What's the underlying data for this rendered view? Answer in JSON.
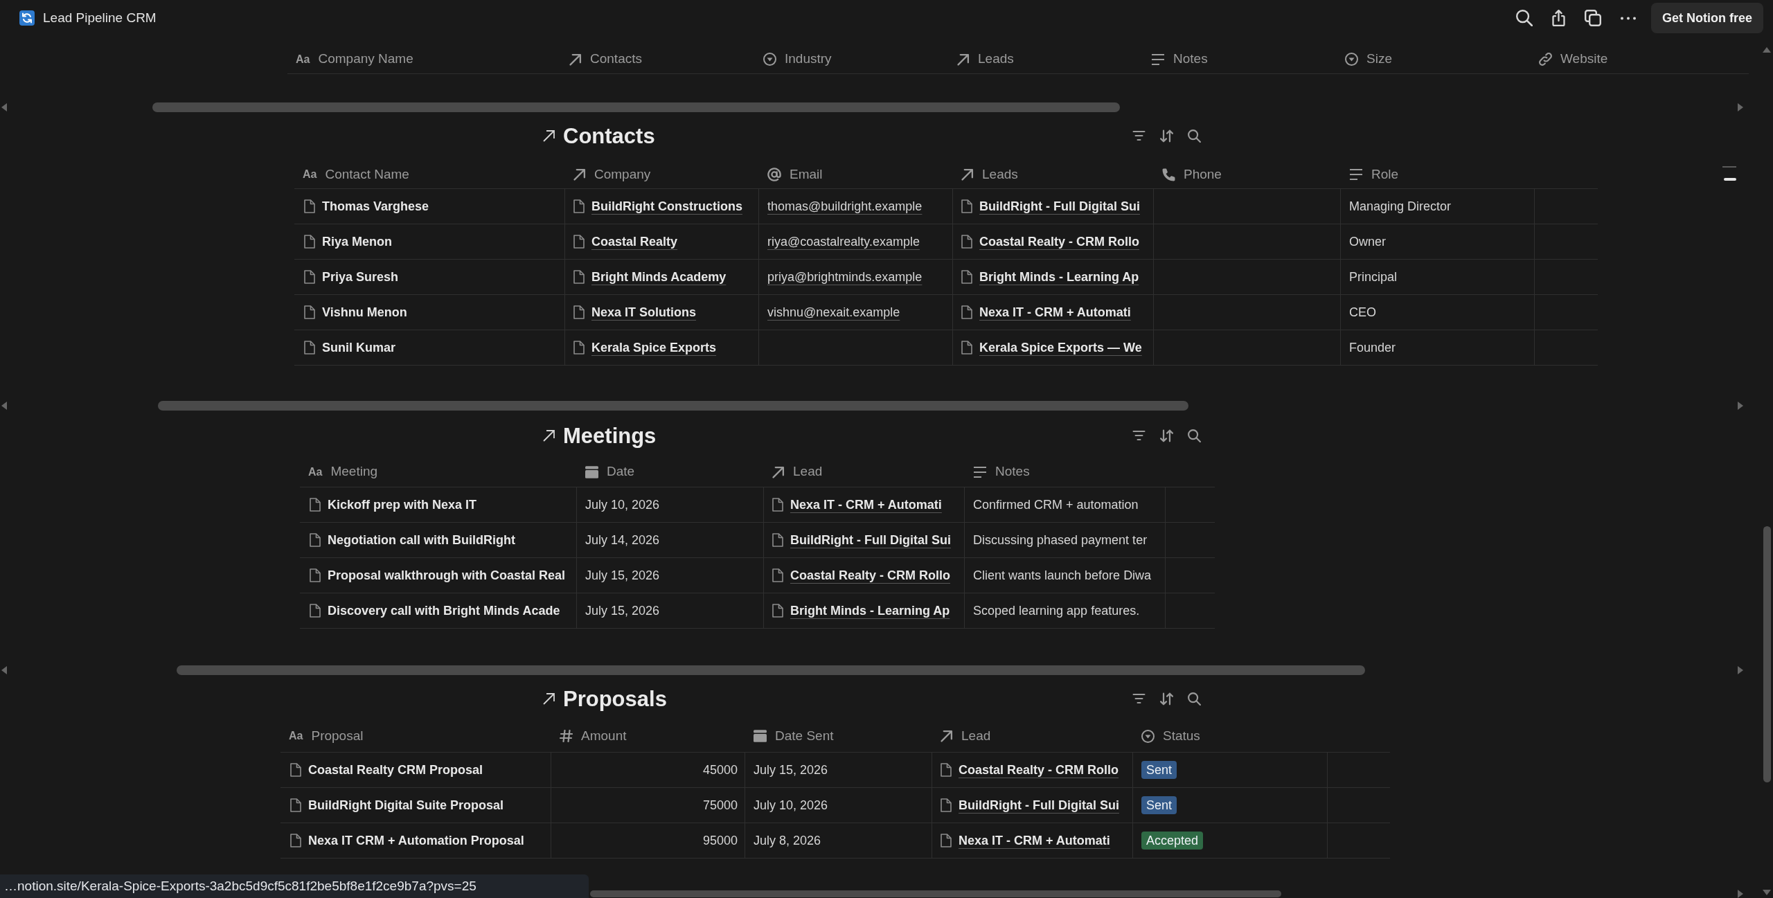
{
  "topbar": {
    "page_title": "Lead Pipeline CRM",
    "cta_button": "Get Notion free"
  },
  "companies_table": {
    "columns": [
      {
        "label": "Company Name",
        "kind": "title",
        "type_glyph": "Aa"
      },
      {
        "label": "Contacts",
        "kind": "relation"
      },
      {
        "label": "Industry",
        "kind": "select"
      },
      {
        "label": "Leads",
        "kind": "relation"
      },
      {
        "label": "Notes",
        "kind": "text"
      },
      {
        "label": "Size",
        "kind": "select"
      },
      {
        "label": "Website",
        "kind": "url"
      }
    ]
  },
  "sections": [
    {
      "title": "Contacts",
      "columns": [
        {
          "label": "Contact Name",
          "kind": "title",
          "type_glyph": "Aa"
        },
        {
          "label": "Company",
          "kind": "relation"
        },
        {
          "label": "Email",
          "kind": "email"
        },
        {
          "label": "Leads",
          "kind": "relation"
        },
        {
          "label": "Phone",
          "kind": "phone"
        },
        {
          "label": "Role",
          "kind": "text"
        }
      ],
      "rows": [
        [
          "Thomas Varghese",
          "BuildRight Constructions",
          "thomas@buildright.example",
          "BuildRight - Full Digital Sui",
          null,
          "Managing Director"
        ],
        [
          "Riya Menon",
          "Coastal Realty",
          "riya@coastalrealty.example",
          "Coastal Realty - CRM Rollo",
          null,
          "Owner"
        ],
        [
          "Priya Suresh",
          "Bright Minds Academy",
          "priya@brightminds.example",
          "Bright Minds - Learning Ap",
          null,
          "Principal"
        ],
        [
          "Vishnu Menon",
          "Nexa IT Solutions",
          "vishnu@nexait.example",
          "Nexa IT - CRM + Automati",
          null,
          "CEO"
        ],
        [
          "Sunil Kumar",
          "Kerala Spice Exports",
          null,
          "Kerala Spice Exports — We",
          null,
          "Founder"
        ]
      ]
    },
    {
      "title": "Meetings",
      "columns": [
        {
          "label": "Meeting",
          "kind": "title",
          "type_glyph": "Aa"
        },
        {
          "label": "Date",
          "kind": "date"
        },
        {
          "label": "Lead",
          "kind": "relation"
        },
        {
          "label": "Notes",
          "kind": "text"
        }
      ],
      "rows": [
        [
          "Kickoff prep with Nexa IT",
          "July 10, 2026",
          "Nexa IT - CRM + Automati",
          "Confirmed CRM + automation"
        ],
        [
          "Negotiation call with BuildRight",
          "July 14, 2026",
          "BuildRight - Full Digital Sui",
          "Discussing phased payment ter"
        ],
        [
          "Proposal walkthrough with Coastal Real",
          "July 15, 2026",
          "Coastal Realty - CRM Rollo",
          "Client wants launch before Diwa"
        ],
        [
          "Discovery call with Bright Minds Acade",
          "July 15, 2026",
          "Bright Minds - Learning Ap",
          "Scoped learning app features."
        ]
      ]
    },
    {
      "title": "Proposals",
      "columns": [
        {
          "label": "Proposal",
          "kind": "title",
          "type_glyph": "Aa"
        },
        {
          "label": "Amount",
          "kind": "number"
        },
        {
          "label": "Date Sent",
          "kind": "date"
        },
        {
          "label": "Lead",
          "kind": "relation"
        },
        {
          "label": "Status",
          "kind": "select"
        }
      ],
      "rows": [
        [
          "Coastal Realty CRM Proposal",
          "45000",
          "July 15, 2026",
          "Coastal Realty - CRM Rollo",
          {
            "label": "Sent",
            "color": "#345a89"
          }
        ],
        [
          "BuildRight Digital Suite Proposal",
          "75000",
          "July 10, 2026",
          "BuildRight - Full Digital Sui",
          {
            "label": "Sent",
            "color": "#345a89"
          }
        ],
        [
          "Nexa IT CRM + Automation Proposal",
          "95000",
          "July 8, 2026",
          "Nexa IT - CRM + Automati",
          {
            "label": "Accepted",
            "color": "#2f6a45"
          }
        ]
      ]
    }
  ],
  "status_bar": {
    "url": "…notion.site/Kerala-Spice-Exports-3a2bc5d9cf5c81f2be5bf8e1f2ce9b7a?pvs=25"
  }
}
